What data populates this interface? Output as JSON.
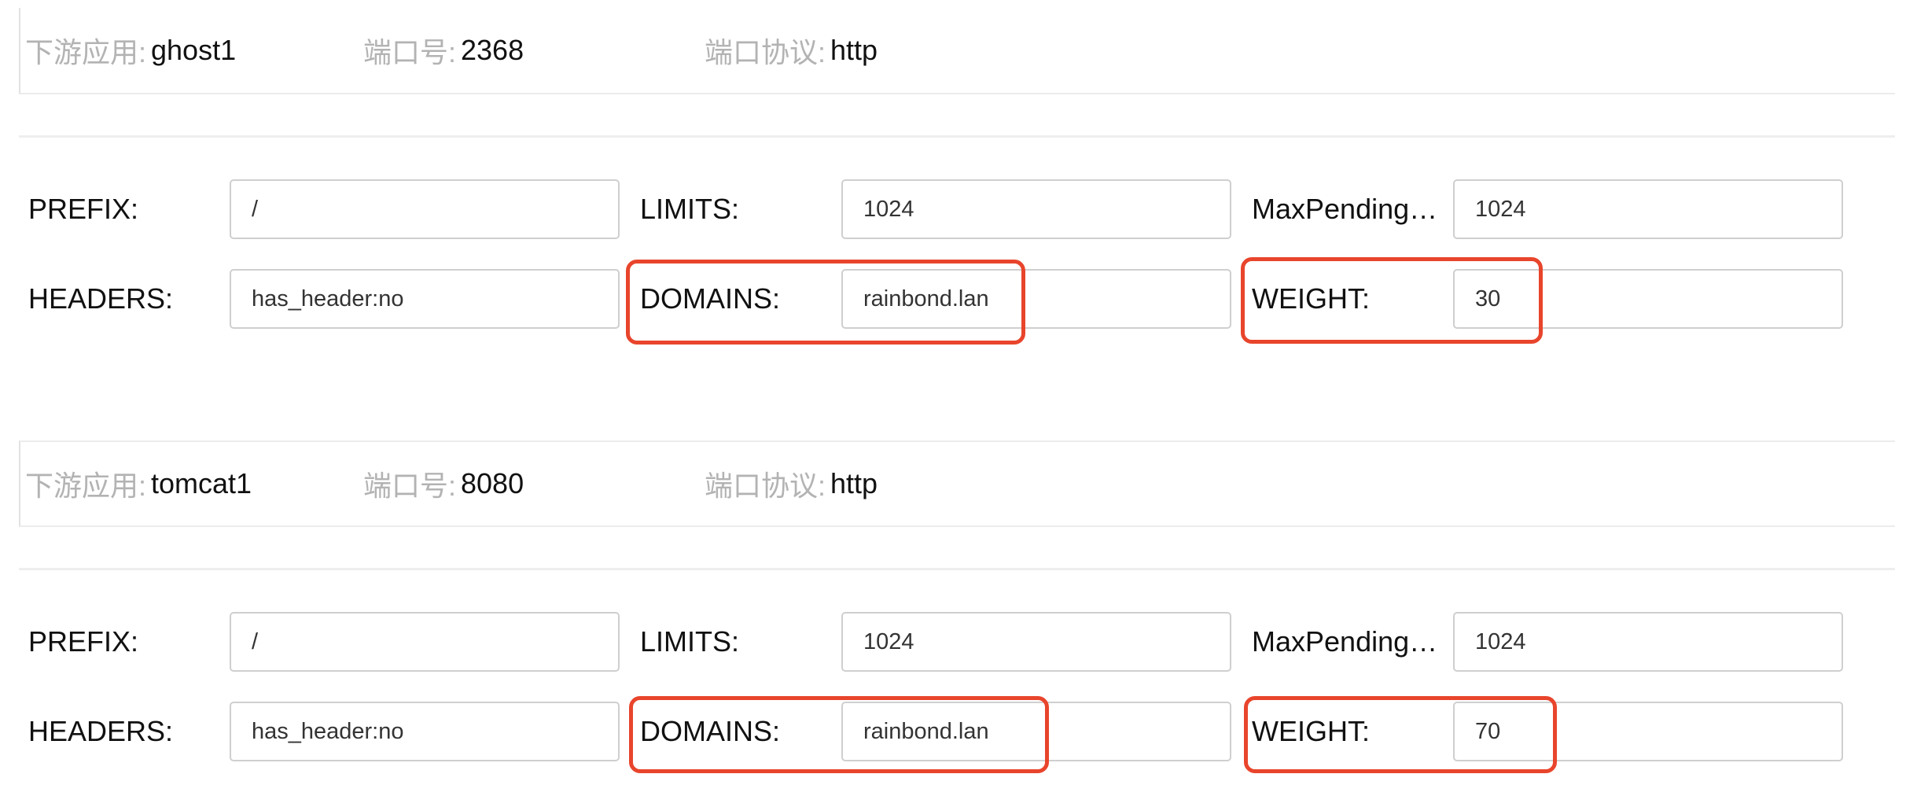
{
  "info_labels": {
    "downstream_app": "下游应用:",
    "port": "端口号:",
    "protocol": "端口协议:"
  },
  "field_labels": {
    "prefix": "PREFIX:",
    "limits": "LIMITS:",
    "max_pending": "MaxPending…",
    "headers": "HEADERS:",
    "domains": "DOMAINS:",
    "weight": "WEIGHT:"
  },
  "routes": [
    {
      "app": "ghost1",
      "port": "2368",
      "protocol": "http",
      "prefix": "/",
      "limits": "1024",
      "max_pending": "1024",
      "headers": "has_header:no",
      "domains": "rainbond.lan",
      "weight": "30"
    },
    {
      "app": "tomcat1",
      "port": "8080",
      "protocol": "http",
      "prefix": "/",
      "limits": "1024",
      "max_pending": "1024",
      "headers": "has_header:no",
      "domains": "rainbond.lan",
      "weight": "70"
    }
  ],
  "colors": {
    "highlight": "#e8452c",
    "muted_label": "#b3b3b3",
    "input_border": "#cfcfcf"
  }
}
